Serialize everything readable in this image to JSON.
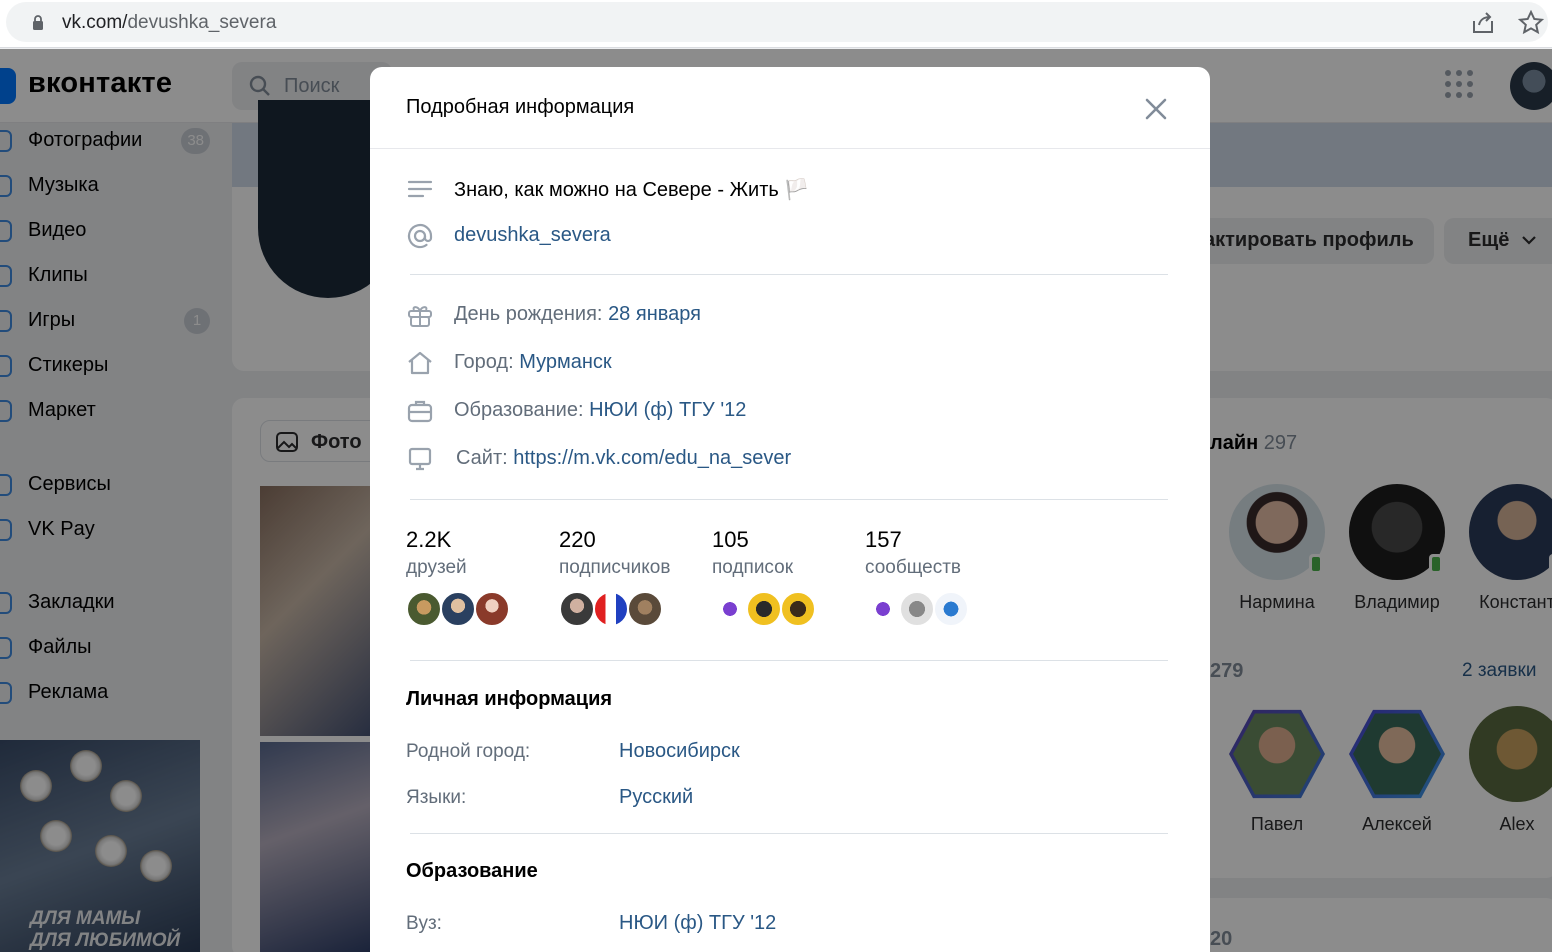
{
  "browser": {
    "url_host": "vk.com/",
    "url_path": "devushka_severa"
  },
  "header": {
    "brand": "вконтакте",
    "search_placeholder": "Поиск"
  },
  "left_menu": [
    {
      "label": "Фотографии",
      "badge": "38"
    },
    {
      "label": "Музыка",
      "badge": ""
    },
    {
      "label": "Видео",
      "badge": ""
    },
    {
      "label": "Клипы",
      "badge": ""
    },
    {
      "label": "Игры",
      "badge": "1"
    },
    {
      "label": "Стикеры",
      "badge": ""
    },
    {
      "label": "Маркет",
      "badge": ""
    },
    {
      "label": "Сервисы",
      "badge": ""
    },
    {
      "label": "VK Pay",
      "badge": ""
    },
    {
      "label": "Закладки",
      "badge": ""
    },
    {
      "label": "Файлы",
      "badge": ""
    },
    {
      "label": "Реклама",
      "badge": ""
    }
  ],
  "promo": {
    "text_line1": "ДЛЯ МАМЫ",
    "text_line2": "ДЛЯ ЛЮБИМОЙ"
  },
  "profile_bg": {
    "edit_button": "актировать профиль",
    "more_button": "Ещё",
    "photos_tab": "Фото"
  },
  "right_panel": {
    "online_label": "лайн",
    "online_count": "297",
    "online_friends": [
      "Нармина",
      "Владимир",
      "Констант"
    ],
    "friends_count_label": "279",
    "requests": "2 заявки",
    "friends": [
      "Павел",
      "Алексей",
      "Alex"
    ],
    "third_count": "20"
  },
  "modal": {
    "title": "Подробная информация",
    "status": "Знаю, как можно на Севере - Жить 🏳️",
    "nickname": "devushka_severa",
    "birthday_label": "День рождения:",
    "birthday_value": "28 января",
    "city_label": "Город:",
    "city_value": "Мурманск",
    "education_label": "Образование:",
    "education_value": "НЮИ (ф) ТГУ '12",
    "site_label": "Сайт:",
    "site_value": "https://m.vk.com/edu_na_sever",
    "stats": [
      {
        "num": "2.2K",
        "caption": "друзей"
      },
      {
        "num": "220",
        "caption": "подписчиков"
      },
      {
        "num": "105",
        "caption": "подписок"
      },
      {
        "num": "157",
        "caption": "сообществ"
      }
    ],
    "personal_title": "Личная информация",
    "hometown_label": "Родной город:",
    "hometown_value": "Новосибирск",
    "languages_label": "Языки:",
    "languages_value": "Русский",
    "education_title": "Образование",
    "university_label": "Вуз:",
    "university_value": "НЮИ (ф) ТГУ '12"
  },
  "colors": {
    "vk_blue": "#0077ff",
    "link": "#2a5885",
    "secondary_text": "#626d7a",
    "online_green": "#4bb34b"
  }
}
